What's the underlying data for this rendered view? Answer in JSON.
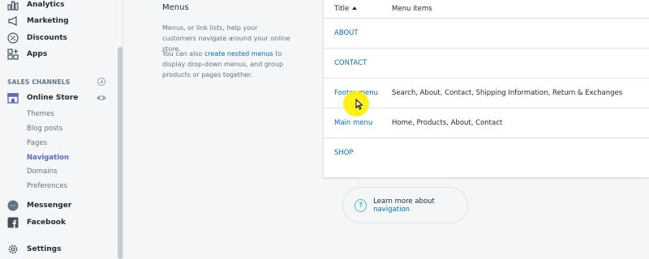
{
  "sidebar": {
    "items": [
      {
        "label": "Analytics",
        "icon": "bar-chart-icon"
      },
      {
        "label": "Marketing",
        "icon": "megaphone-icon"
      },
      {
        "label": "Discounts",
        "icon": "discount-icon"
      },
      {
        "label": "Apps",
        "icon": "apps-icon"
      }
    ],
    "sales_channels_heading": "SALES CHANNELS",
    "online_store": {
      "label": "Online Store",
      "sub_items": [
        "Themes",
        "Blog posts",
        "Pages",
        "Navigation",
        "Domains",
        "Preferences"
      ],
      "active_sub_item": "Navigation"
    },
    "messenger_label": "Messenger",
    "facebook_label": "Facebook",
    "settings_label": "Settings"
  },
  "main": {
    "title": "Menus",
    "description": "Menus, or link lists, help your customers navigate around your online store.",
    "nested_prefix": "You can also ",
    "nested_link": "create nested menus",
    "nested_suffix": " to display drop-down menus, and group products or pages together.",
    "table": {
      "columns": [
        "Title",
        "Menu items"
      ],
      "rows": [
        {
          "title": "ABOUT",
          "items": ""
        },
        {
          "title": "CONTACT",
          "items": ""
        },
        {
          "title": "Footer menu",
          "items": "Search, About, Contact, Shipping Information, Return & Exchanges"
        },
        {
          "title": "Main menu",
          "items": "Home, Products, About, Contact"
        },
        {
          "title": "SHOP",
          "items": ""
        }
      ]
    },
    "learn_more_prefix": "Learn more about ",
    "learn_more_link": "navigation"
  },
  "colors": {
    "accent": "#5c6ac4",
    "link": "#006fbb",
    "highlight": "#fff000",
    "help_icon": "#47c1bf"
  }
}
